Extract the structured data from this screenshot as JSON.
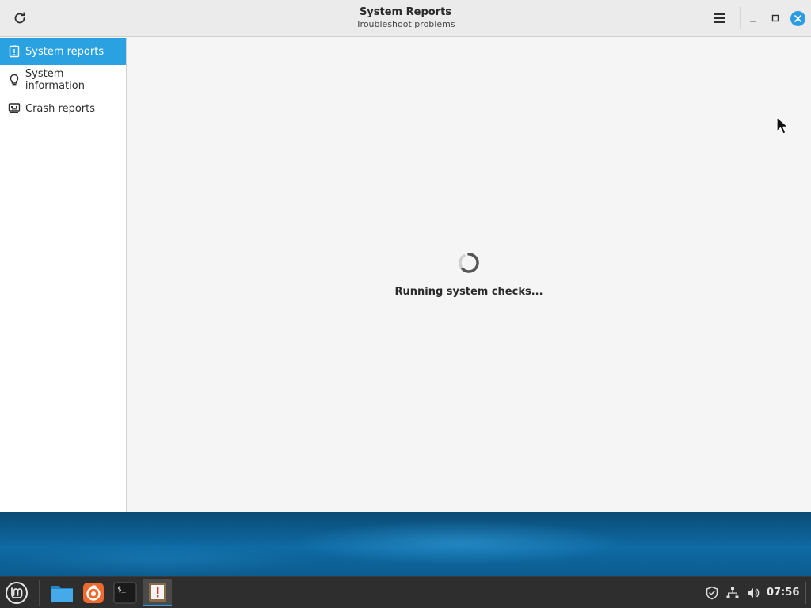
{
  "window": {
    "title": "System Reports",
    "subtitle": "Troubleshoot problems"
  },
  "titlebar": {
    "refresh_icon": "refresh-icon",
    "menu_icon": "hamburger-menu-icon",
    "minimize_icon": "minimize-icon",
    "maximize_icon": "maximize-icon",
    "close_icon": "close-icon"
  },
  "sidebar": {
    "items": [
      {
        "label": "System reports",
        "icon": "report-icon",
        "active": true
      },
      {
        "label": "System information",
        "icon": "lightbulb-icon",
        "active": false
      },
      {
        "label": "Crash reports",
        "icon": "crash-monitor-icon",
        "active": false
      }
    ]
  },
  "content": {
    "status": "Running system checks..."
  },
  "taskbar": {
    "launchers": [
      {
        "name": "mint-menu",
        "icon": "linux-mint-icon"
      },
      {
        "name": "files",
        "icon": "folder-icon"
      },
      {
        "name": "firefox",
        "icon": "firefox-icon"
      },
      {
        "name": "terminal",
        "icon": "terminal-icon",
        "text": "$_"
      },
      {
        "name": "system-reports",
        "icon": "system-reports-icon",
        "active": true
      }
    ],
    "tray": [
      "shield-icon",
      "network-icon",
      "volume-icon"
    ],
    "clock": "07:56"
  },
  "colors": {
    "accent": "#2aa2e1",
    "taskbar": "#2e2e2e",
    "window_bg": "#f5f5f5"
  }
}
